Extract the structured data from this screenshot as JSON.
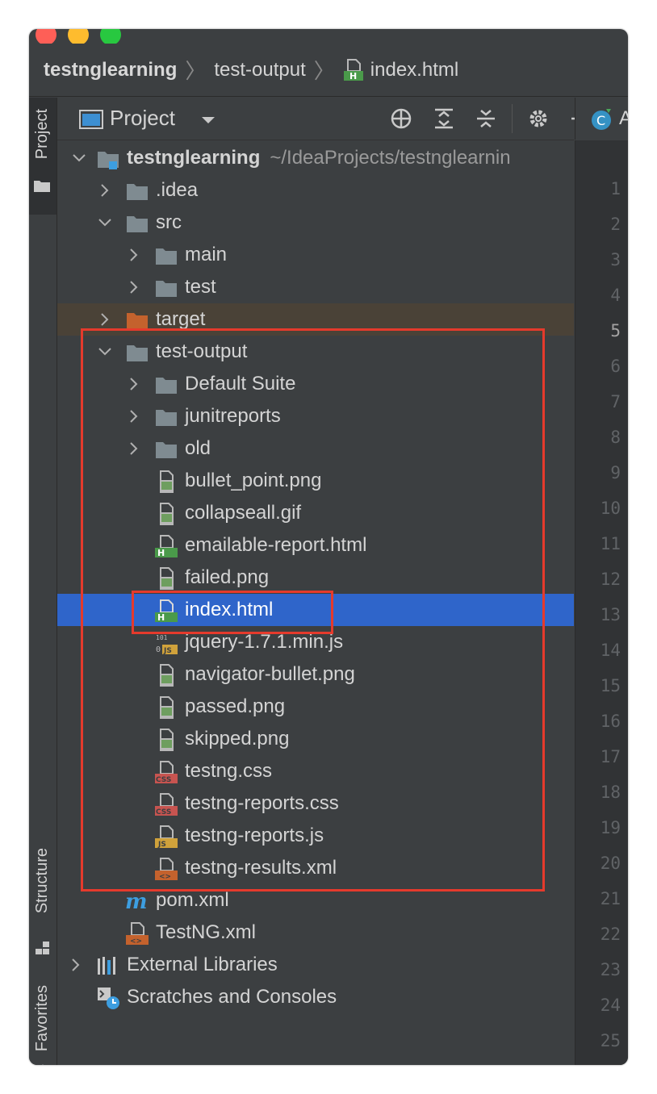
{
  "breadcrumb": {
    "root": "testnglearning",
    "middle": "test-output",
    "file": "index.html"
  },
  "left_stripe": {
    "project_tab": "Project",
    "structure_tab": "Structure",
    "favorites_tab": "Favorites"
  },
  "panel": {
    "title": "Project",
    "icons": [
      "locate-icon",
      "expand-all-icon",
      "collapse-all-icon",
      "gear-icon",
      "minimize-icon"
    ]
  },
  "editor": {
    "tab_label": "A"
  },
  "tree": {
    "root": {
      "label": "testnglearning",
      "path": "~/IdeaProjects/testnglearnin"
    },
    "items": [
      {
        "label": ".idea"
      },
      {
        "label": "src"
      },
      {
        "label": "main"
      },
      {
        "label": "test"
      },
      {
        "label": "target"
      },
      {
        "label": "test-output"
      },
      {
        "label": "Default Suite"
      },
      {
        "label": "junitreports"
      },
      {
        "label": "old"
      },
      {
        "label": "bullet_point.png"
      },
      {
        "label": "collapseall.gif"
      },
      {
        "label": "emailable-report.html"
      },
      {
        "label": "failed.png"
      },
      {
        "label": "index.html"
      },
      {
        "label": "jquery-1.7.1.min.js"
      },
      {
        "label": "navigator-bullet.png"
      },
      {
        "label": "passed.png"
      },
      {
        "label": "skipped.png"
      },
      {
        "label": "testng.css"
      },
      {
        "label": "testng-reports.css"
      },
      {
        "label": "testng-reports.js"
      },
      {
        "label": "testng-results.xml"
      },
      {
        "label": "pom.xml"
      },
      {
        "label": "TestNG.xml"
      },
      {
        "label": "External Libraries"
      },
      {
        "label": "Scratches and Consoles"
      }
    ]
  },
  "gutter_lines": [
    "1",
    "2",
    "3",
    "4",
    "5",
    "6",
    "7",
    "8",
    "9",
    "10",
    "11",
    "12",
    "13",
    "14",
    "15",
    "16",
    "17",
    "18",
    "19",
    "20",
    "21",
    "22",
    "23",
    "24",
    "25"
  ],
  "colors": {
    "background": "#3c3f41",
    "selection": "#2f65ca",
    "highlight_box": "#e53a2c",
    "folder": "#7f8b91",
    "excluded_folder": "#c4622d",
    "html_badge": "#4a9a4a",
    "css_badge": "#c75450",
    "js_badge": "#d0a23b"
  }
}
